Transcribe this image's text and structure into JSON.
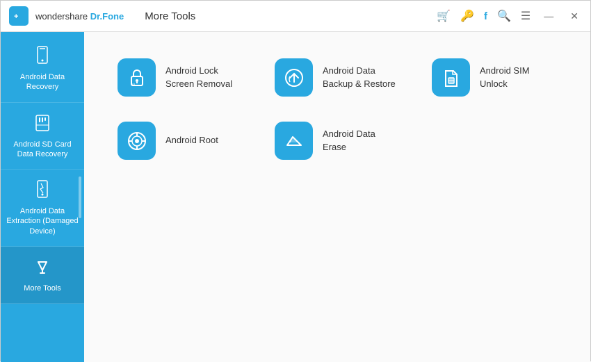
{
  "titleBar": {
    "appName": "Dr.Fone",
    "pageTitle": "More Tools",
    "icons": {
      "cart": "🛒",
      "key": "🔑",
      "facebook": "f",
      "search": "🔍",
      "menu": "≡",
      "minimize": "—",
      "close": "✕"
    }
  },
  "sidebar": {
    "items": [
      {
        "id": "android-data-recovery",
        "label": "Android Data Recovery",
        "icon": "phone"
      },
      {
        "id": "android-sd-card",
        "label": "Android SD Card Data Recovery",
        "icon": "sdcard"
      },
      {
        "id": "android-data-extraction",
        "label": "Android Data Extraction (Damaged Device)",
        "icon": "cracked-phone"
      },
      {
        "id": "more-tools",
        "label": "More Tools",
        "icon": "tools",
        "active": true
      }
    ]
  },
  "tools": [
    {
      "id": "lock-screen-removal",
      "label": "Android Lock Screen Removal",
      "icon": "lock"
    },
    {
      "id": "data-backup-restore",
      "label": "Android Data Backup & Restore",
      "icon": "backup"
    },
    {
      "id": "sim-unlock",
      "label": "Android SIM Unlock",
      "icon": "sim"
    },
    {
      "id": "android-root",
      "label": "Android Root",
      "icon": "root"
    },
    {
      "id": "data-erase",
      "label": "Android Data Erase",
      "icon": "erase"
    }
  ]
}
